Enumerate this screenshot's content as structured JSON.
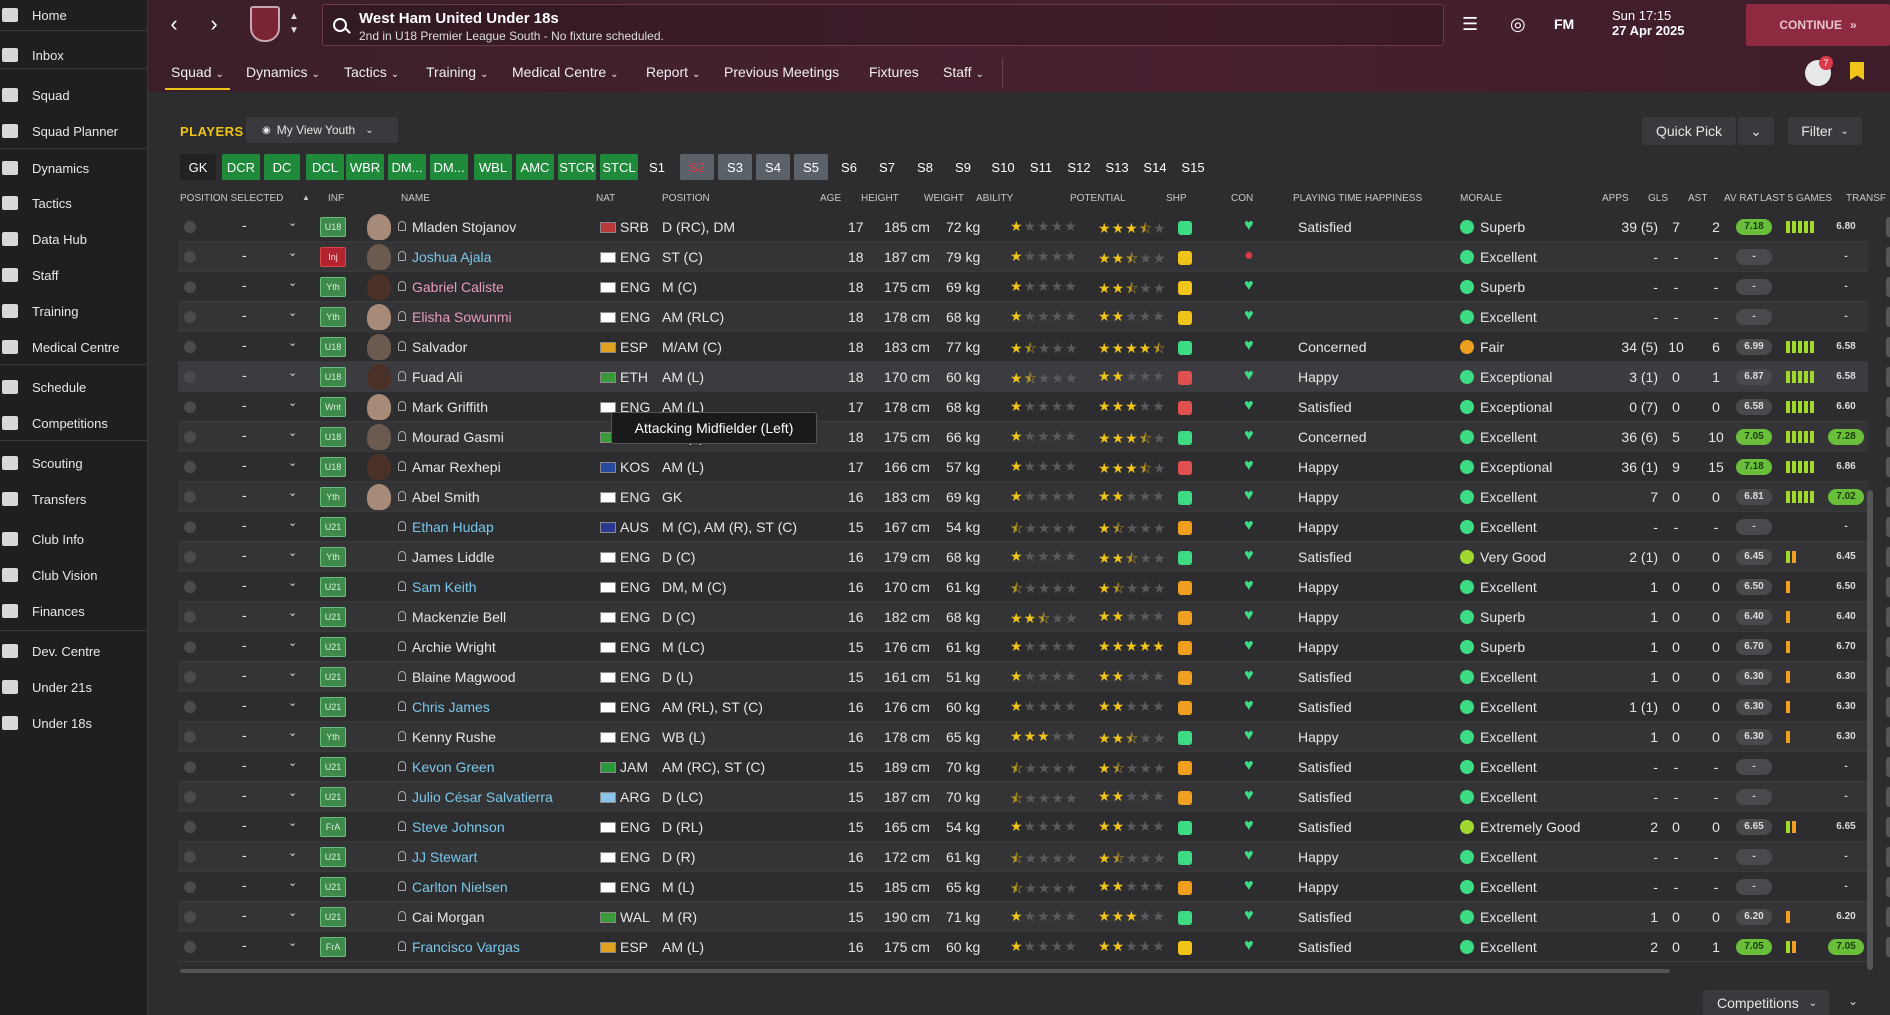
{
  "sidebar": {
    "items": [
      {
        "label": "Home",
        "icon": "home-icon"
      },
      {
        "label": "Inbox",
        "icon": "inbox-icon"
      },
      {
        "label": "Squad",
        "icon": "shirt-icon"
      },
      {
        "label": "Squad Planner",
        "icon": "planner-icon"
      },
      {
        "label": "Dynamics",
        "icon": "dynamics-icon"
      },
      {
        "label": "Tactics",
        "icon": "tactics-icon"
      },
      {
        "label": "Data Hub",
        "icon": "data-hub-icon"
      },
      {
        "label": "Staff",
        "icon": "staff-icon"
      },
      {
        "label": "Training",
        "icon": "training-icon"
      },
      {
        "label": "Medical Centre",
        "icon": "medical-icon"
      },
      {
        "label": "Schedule",
        "icon": "calendar-icon"
      },
      {
        "label": "Competitions",
        "icon": "trophy-icon"
      },
      {
        "label": "Scouting",
        "icon": "scouting-icon"
      },
      {
        "label": "Transfers",
        "icon": "transfers-icon"
      },
      {
        "label": "Club Info",
        "icon": "shield-icon"
      },
      {
        "label": "Club Vision",
        "icon": "vision-icon"
      },
      {
        "label": "Finances",
        "icon": "finances-icon"
      },
      {
        "label": "Dev. Centre",
        "icon": "dev-centre-icon"
      },
      {
        "label": "Under 21s",
        "icon": "u21-icon"
      },
      {
        "label": "Under 18s",
        "icon": "u18-icon"
      }
    ]
  },
  "header": {
    "team_title": "West Ham United Under 18s",
    "team_subtitle": "2nd in U18 Premier League South - No fixture scheduled.",
    "fm_label": "FM",
    "day_time": "Sun 17:15",
    "date": "27 Apr 2025",
    "continue_label": "CONTINUE",
    "continue_arrows": "»",
    "notification_count": "7"
  },
  "tabs": [
    {
      "label": "Squad",
      "caret": "⌄"
    },
    {
      "label": "Dynamics",
      "caret": "⌄"
    },
    {
      "label": "Tactics",
      "caret": "⌄"
    },
    {
      "label": "Training",
      "caret": "⌄"
    },
    {
      "label": "Medical Centre",
      "caret": "⌄"
    },
    {
      "label": "Report",
      "caret": "⌄"
    },
    {
      "label": "Previous Meetings",
      "caret": ""
    },
    {
      "label": "Fixtures",
      "caret": ""
    },
    {
      "label": "Staff",
      "caret": "⌄"
    }
  ],
  "toolbar": {
    "players_label": "PLAYERS",
    "view_label": "My View Youth",
    "quick_pick_label": "Quick Pick",
    "filter_label": "Filter"
  },
  "position_filters": [
    "GK",
    "DCR",
    "DC",
    "DCL",
    "WBR",
    "DM...",
    "DM...",
    "WBL",
    "AMC",
    "STCR",
    "STCL",
    "S1",
    "S2",
    "S3",
    "S4",
    "S5",
    "S6",
    "S7",
    "S8",
    "S9",
    "S10",
    "S11",
    "S12",
    "S13",
    "S14",
    "S15"
  ],
  "columns": {
    "position_selected": "POSITION SELECTED",
    "inf": "INF",
    "name": "NAME",
    "nat": "NAT",
    "position": "POSITION",
    "age": "AGE",
    "height": "HEIGHT",
    "weight": "WEIGHT",
    "ability": "ABILITY",
    "potential": "POTENTIAL",
    "shp": "SHP",
    "con": "CON",
    "pth": "PLAYING TIME HAPPINESS",
    "morale": "MORALE",
    "apps": "APPS",
    "gls": "GLS",
    "ast": "AST",
    "av_rat": "AV RAT",
    "last5": "LAST 5 GAMES",
    "trans": "TRANSF"
  },
  "players": [
    {
      "sel": "-",
      "inf": "U18",
      "name": "Mladen Stojanov",
      "nat": "SRB",
      "flag": "#b83a3a",
      "pos": "D (RC), DM",
      "age": "17",
      "height": "185 cm",
      "weight": "72 kg",
      "ability": 1,
      "potential": 3.5,
      "shp": "#3ddc84",
      "con": "heart",
      "pth": "Satisfied",
      "morale": "Superb",
      "mor_color": "green",
      "apps": "39 (5)",
      "gls": "7",
      "ast": "2",
      "avr": "7.18",
      "avr_good": true,
      "last5": "|||||",
      "l5": "6.80",
      "l5_good": false
    },
    {
      "sel": "-",
      "inf": "Inj",
      "name": "Joshua Ajala",
      "nat": "ENG",
      "flag": "#ffffff",
      "pos": "ST (C)",
      "age": "18",
      "height": "187 cm",
      "weight": "79 kg",
      "ability": 1,
      "potential": 2.5,
      "shp": "#f0c419",
      "con": "red",
      "pth": "",
      "morale": "Excellent",
      "mor_color": "green",
      "apps": "-",
      "gls": "-",
      "ast": "-",
      "avr": "-",
      "avr_good": false,
      "last5": "",
      "l5": "-",
      "l5_good": false
    },
    {
      "sel": "-",
      "inf": "Yth",
      "name": "Gabriel Caliste",
      "nat": "ENG",
      "flag": "#ffffff",
      "pos": "M (C)",
      "age": "18",
      "height": "175 cm",
      "weight": "69 kg",
      "ability": 1,
      "potential": 2.5,
      "shp": "#f0c419",
      "con": "heart",
      "pth": "",
      "morale": "Superb",
      "mor_color": "green",
      "apps": "-",
      "gls": "-",
      "ast": "-",
      "avr": "-",
      "avr_good": false,
      "last5": "",
      "l5": "-",
      "l5_good": false
    },
    {
      "sel": "-",
      "inf": "Yth",
      "name": "Elisha Sowunmi",
      "nat": "ENG",
      "flag": "#ffffff",
      "pos": "AM (RLC)",
      "age": "18",
      "height": "178 cm",
      "weight": "68 kg",
      "ability": 1,
      "potential": 2,
      "shp": "#f0c419",
      "con": "heart",
      "pth": "",
      "morale": "Excellent",
      "mor_color": "green",
      "apps": "-",
      "gls": "-",
      "ast": "-",
      "avr": "-",
      "avr_good": false,
      "last5": "",
      "l5": "-",
      "l5_good": false
    },
    {
      "sel": "-",
      "inf": "U18",
      "name": "Salvador",
      "nat": "ESP",
      "flag": "#e0a020",
      "pos": "M/AM (C)",
      "age": "18",
      "height": "183 cm",
      "weight": "77 kg",
      "ability": 1.5,
      "potential": 4.5,
      "shp": "#3ddc84",
      "con": "heart",
      "pth": "Concerned",
      "morale": "Fair",
      "mor_color": "orange",
      "apps": "34 (5)",
      "gls": "10",
      "ast": "6",
      "avr": "6.99",
      "avr_good": false,
      "last5": "|||||",
      "l5": "6.58",
      "l5_good": false
    },
    {
      "sel": "-",
      "inf": "U18",
      "name": "Fuad Ali",
      "nat": "ETH",
      "flag": "#3a9a3a",
      "pos": "AM (L)",
      "age": "18",
      "height": "170 cm",
      "weight": "60 kg",
      "ability": 1.5,
      "potential": 2,
      "shp": "#e05050",
      "con": "heart",
      "pth": "Happy",
      "morale": "Exceptional",
      "mor_color": "green",
      "apps": "3 (1)",
      "gls": "0",
      "ast": "1",
      "avr": "6.87",
      "avr_good": false,
      "last5": "|||||",
      "l5": "6.58",
      "l5_good": false
    },
    {
      "sel": "-",
      "inf": "Wnt",
      "name": "Mark Griffith",
      "nat": "ENG",
      "flag": "#ffffff",
      "pos": "AM (L)",
      "age": "17",
      "height": "178 cm",
      "weight": "68 kg",
      "ability": 1,
      "potential": 3,
      "shp": "#e05050",
      "con": "heart",
      "pth": "Satisfied",
      "morale": "Exceptional",
      "mor_color": "green",
      "apps": "0 (7)",
      "gls": "0",
      "ast": "0",
      "avr": "6.58",
      "avr_good": false,
      "last5": "|||||",
      "l5": "6.60",
      "l5_good": false
    },
    {
      "sel": "-",
      "inf": "U18",
      "name": "Mourad Gasmi",
      "nat": "ALG",
      "flag": "#3a9a3a",
      "pos": "AM (L)",
      "age": "18",
      "height": "175 cm",
      "weight": "66 kg",
      "ability": 1,
      "potential": 3.5,
      "shp": "#3ddc84",
      "con": "heart",
      "pth": "Concerned",
      "morale": "Excellent",
      "mor_color": "green",
      "apps": "36 (6)",
      "gls": "5",
      "ast": "10",
      "avr": "7.05",
      "avr_good": true,
      "last5": "|||||",
      "l5": "7.28",
      "l5_good": true
    },
    {
      "sel": "-",
      "inf": "U18",
      "name": "Amar Rexhepi",
      "nat": "KOS",
      "flag": "#2a4aa0",
      "pos": "AM (L)",
      "age": "17",
      "height": "166 cm",
      "weight": "57 kg",
      "ability": 1,
      "potential": 3.5,
      "shp": "#e05050",
      "con": "heart",
      "pth": "Happy",
      "morale": "Exceptional",
      "mor_color": "green",
      "apps": "36 (1)",
      "gls": "9",
      "ast": "15",
      "avr": "7.18",
      "avr_good": true,
      "last5": "|||||",
      "l5": "6.86",
      "l5_good": false
    },
    {
      "sel": "-",
      "inf": "Yth",
      "name": "Abel Smith",
      "nat": "ENG",
      "flag": "#ffffff",
      "pos": "GK",
      "age": "16",
      "height": "183 cm",
      "weight": "69 kg",
      "ability": 1,
      "potential": 2,
      "shp": "#3ddc84",
      "con": "heart",
      "pth": "Happy",
      "morale": "Excellent",
      "mor_color": "green",
      "apps": "7",
      "gls": "0",
      "ast": "0",
      "avr": "6.81",
      "avr_good": false,
      "last5": "|||||",
      "l5": "7.02",
      "l5_good": true
    },
    {
      "sel": "-",
      "inf": "U21",
      "name": "Ethan Hudap",
      "nat": "AUS",
      "flag": "#2a3a90",
      "pos": "M (C), AM (R), ST (C)",
      "age": "15",
      "height": "167 cm",
      "weight": "54 kg",
      "ability": 0.5,
      "potential": 1.5,
      "shp": "#f0a020",
      "con": "heart",
      "pth": "Happy",
      "morale": "Excellent",
      "mor_color": "green",
      "apps": "-",
      "gls": "-",
      "ast": "-",
      "avr": "-",
      "avr_good": false,
      "last5": "",
      "l5": "-",
      "l5_good": false
    },
    {
      "sel": "-",
      "inf": "Yth",
      "name": "James Liddle",
      "nat": "ENG",
      "flag": "#ffffff",
      "pos": "D (C)",
      "age": "16",
      "height": "179 cm",
      "weight": "68 kg",
      "ability": 1,
      "potential": 2.5,
      "shp": "#3ddc84",
      "con": "heart",
      "pth": "Satisfied",
      "morale": "Very Good",
      "mor_color": "lime",
      "apps": "2 (1)",
      "gls": "0",
      "ast": "0",
      "avr": "6.45",
      "avr_good": false,
      "last5": "||",
      "l5": "6.45",
      "l5_good": false
    },
    {
      "sel": "-",
      "inf": "U21",
      "name": "Sam Keith",
      "nat": "ENG",
      "flag": "#ffffff",
      "pos": "DM, M (C)",
      "age": "16",
      "height": "170 cm",
      "weight": "61 kg",
      "ability": 0.5,
      "potential": 1.5,
      "shp": "#f0a020",
      "con": "heart",
      "pth": "Happy",
      "morale": "Excellent",
      "mor_color": "green",
      "apps": "1",
      "gls": "0",
      "ast": "0",
      "avr": "6.50",
      "avr_good": false,
      "last5": "|",
      "l5": "6.50",
      "l5_good": false
    },
    {
      "sel": "-",
      "inf": "U21",
      "name": "Mackenzie Bell",
      "nat": "ENG",
      "flag": "#ffffff",
      "pos": "D (C)",
      "age": "16",
      "height": "182 cm",
      "weight": "68 kg",
      "ability": 2.5,
      "potential": 2,
      "shp": "#f0a020",
      "con": "heart",
      "pth": "Happy",
      "morale": "Superb",
      "mor_color": "green",
      "apps": "1",
      "gls": "0",
      "ast": "0",
      "avr": "6.40",
      "avr_good": false,
      "last5": "|",
      "l5": "6.40",
      "l5_good": false
    },
    {
      "sel": "-",
      "inf": "U21",
      "name": "Archie Wright",
      "nat": "ENG",
      "flag": "#ffffff",
      "pos": "M (LC)",
      "age": "15",
      "height": "176 cm",
      "weight": "61 kg",
      "ability": 1,
      "potential": 5,
      "shp": "#f0a020",
      "con": "heart",
      "pth": "Happy",
      "morale": "Superb",
      "mor_color": "green",
      "apps": "1",
      "gls": "0",
      "ast": "0",
      "avr": "6.70",
      "avr_good": false,
      "last5": "|",
      "l5": "6.70",
      "l5_good": false
    },
    {
      "sel": "-",
      "inf": "U21",
      "name": "Blaine Magwood",
      "nat": "ENG",
      "flag": "#ffffff",
      "pos": "D (L)",
      "age": "15",
      "height": "161 cm",
      "weight": "51 kg",
      "ability": 1,
      "potential": 2,
      "shp": "#f0a020",
      "con": "heart",
      "pth": "Satisfied",
      "morale": "Excellent",
      "mor_color": "green",
      "apps": "1",
      "gls": "0",
      "ast": "0",
      "avr": "6.30",
      "avr_good": false,
      "last5": "|",
      "l5": "6.30",
      "l5_good": false
    },
    {
      "sel": "-",
      "inf": "U21",
      "name": "Chris James",
      "nat": "ENG",
      "flag": "#ffffff",
      "pos": "AM (RL), ST (C)",
      "age": "16",
      "height": "176 cm",
      "weight": "60 kg",
      "ability": 1,
      "potential": 2,
      "shp": "#f0a020",
      "con": "heart",
      "pth": "Satisfied",
      "morale": "Excellent",
      "mor_color": "green",
      "apps": "1 (1)",
      "gls": "0",
      "ast": "0",
      "avr": "6.30",
      "avr_good": false,
      "last5": "|",
      "l5": "6.30",
      "l5_good": false
    },
    {
      "sel": "-",
      "inf": "Yth",
      "name": "Kenny Rushe",
      "nat": "ENG",
      "flag": "#ffffff",
      "pos": "WB (L)",
      "age": "16",
      "height": "178 cm",
      "weight": "65 kg",
      "ability": 3,
      "potential": 2.5,
      "shp": "#3ddc84",
      "con": "heart",
      "pth": "Happy",
      "morale": "Excellent",
      "mor_color": "green",
      "apps": "1",
      "gls": "0",
      "ast": "0",
      "avr": "6.30",
      "avr_good": false,
      "last5": "|",
      "l5": "6.30",
      "l5_good": false
    },
    {
      "sel": "-",
      "inf": "U21",
      "name": "Kevon Green",
      "nat": "JAM",
      "flag": "#2a9a3a",
      "pos": "AM (RC), ST (C)",
      "age": "15",
      "height": "189 cm",
      "weight": "70 kg",
      "ability": 0.5,
      "potential": 1.5,
      "shp": "#f0a020",
      "con": "heart",
      "pth": "Satisfied",
      "morale": "Excellent",
      "mor_color": "green",
      "apps": "-",
      "gls": "-",
      "ast": "-",
      "avr": "-",
      "avr_good": false,
      "last5": "",
      "l5": "-",
      "l5_good": false
    },
    {
      "sel": "-",
      "inf": "U21",
      "name": "Julio César Salvatierra",
      "nat": "ARG",
      "flag": "#8ac4e8",
      "pos": "D (LC)",
      "age": "15",
      "height": "187 cm",
      "weight": "70 kg",
      "ability": 0.5,
      "potential": 2,
      "shp": "#f0a020",
      "con": "heart",
      "pth": "Satisfied",
      "morale": "Excellent",
      "mor_color": "green",
      "apps": "-",
      "gls": "-",
      "ast": "-",
      "avr": "-",
      "avr_good": false,
      "last5": "",
      "l5": "-",
      "l5_good": false
    },
    {
      "sel": "-",
      "inf": "FrA",
      "name": "Steve Johnson",
      "nat": "ENG",
      "flag": "#ffffff",
      "pos": "D (RL)",
      "age": "15",
      "height": "165 cm",
      "weight": "54 kg",
      "ability": 1,
      "potential": 2,
      "shp": "#3ddc84",
      "con": "heart",
      "pth": "Satisfied",
      "morale": "Extremely Good",
      "mor_color": "lime",
      "apps": "2",
      "gls": "0",
      "ast": "0",
      "avr": "6.65",
      "avr_good": false,
      "last5": "||",
      "l5": "6.65",
      "l5_good": false
    },
    {
      "sel": "-",
      "inf": "U21",
      "name": "JJ Stewart",
      "nat": "ENG",
      "flag": "#ffffff",
      "pos": "D (R)",
      "age": "16",
      "height": "172 cm",
      "weight": "61 kg",
      "ability": 0.5,
      "potential": 1.5,
      "shp": "#3ddc84",
      "con": "heart",
      "pth": "Happy",
      "morale": "Excellent",
      "mor_color": "green",
      "apps": "-",
      "gls": "-",
      "ast": "-",
      "avr": "-",
      "avr_good": false,
      "last5": "",
      "l5": "-",
      "l5_good": false
    },
    {
      "sel": "-",
      "inf": "U21",
      "name": "Carlton Nielsen",
      "nat": "ENG",
      "flag": "#ffffff",
      "pos": "M (L)",
      "age": "15",
      "height": "185 cm",
      "weight": "65 kg",
      "ability": 0.5,
      "potential": 2,
      "shp": "#f0a020",
      "con": "heart",
      "pth": "Happy",
      "morale": "Excellent",
      "mor_color": "green",
      "apps": "-",
      "gls": "-",
      "ast": "-",
      "avr": "-",
      "avr_good": false,
      "last5": "",
      "l5": "-",
      "l5_good": false
    },
    {
      "sel": "-",
      "inf": "U21",
      "name": "Cai Morgan",
      "nat": "WAL",
      "flag": "#3a9a3a",
      "pos": "M (R)",
      "age": "15",
      "height": "190 cm",
      "weight": "71 kg",
      "ability": 1,
      "potential": 3,
      "shp": "#3ddc84",
      "con": "heart",
      "pth": "Satisfied",
      "morale": "Excellent",
      "mor_color": "green",
      "apps": "1",
      "gls": "0",
      "ast": "0",
      "avr": "6.20",
      "avr_good": false,
      "last5": "|",
      "l5": "6.20",
      "l5_good": false
    },
    {
      "sel": "-",
      "inf": "FrA",
      "name": "Francisco Vargas",
      "nat": "ESP",
      "flag": "#e0a020",
      "pos": "AM (L)",
      "age": "16",
      "height": "175 cm",
      "weight": "60 kg",
      "ability": 1,
      "potential": 2,
      "shp": "#f0c419",
      "con": "heart",
      "pth": "Satisfied",
      "morale": "Excellent",
      "mor_color": "green",
      "apps": "2",
      "gls": "0",
      "ast": "1",
      "avr": "7.05",
      "avr_good": true,
      "last5": "||",
      "l5": "7.05",
      "l5_good": true
    }
  ],
  "tooltip": "Attacking Midfielder (Left)",
  "footer": {
    "competitions_label": "Competitions"
  }
}
